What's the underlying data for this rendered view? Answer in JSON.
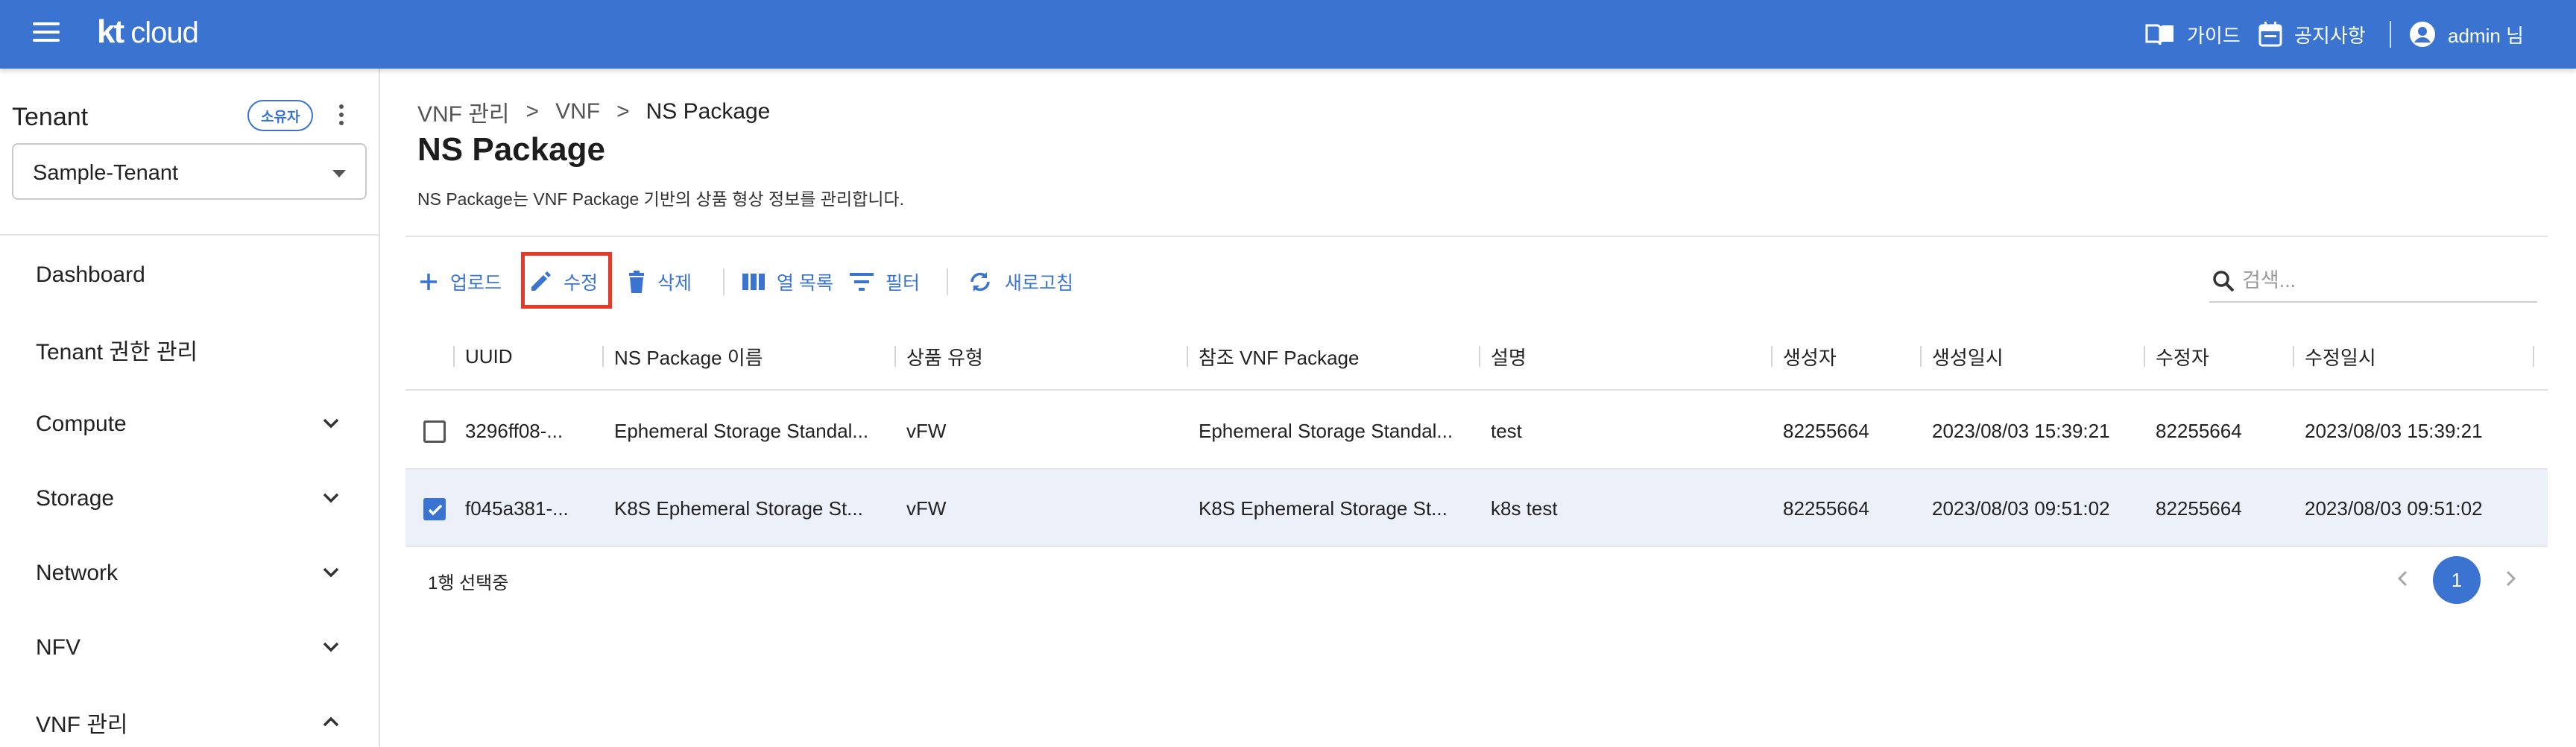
{
  "header": {
    "logo_kt": "kt",
    "logo_cloud": "cloud",
    "guide_label": "가이드",
    "notice_label": "공지사항",
    "user_label": "admin 님",
    "accent": "#3a74d0"
  },
  "sidebar": {
    "tenant_title": "Tenant",
    "owner_badge": "소유자",
    "tenant_value": "Sample-Tenant",
    "items": [
      {
        "label": "Dashboard",
        "expand": "none"
      },
      {
        "label": "Tenant 권한 관리",
        "expand": "none"
      },
      {
        "label": "Compute",
        "expand": "chevron-down"
      },
      {
        "label": "Storage",
        "expand": "chevron-down"
      },
      {
        "label": "Network",
        "expand": "chevron-down"
      },
      {
        "label": "NFV",
        "expand": "chevron-down"
      },
      {
        "label": "VNF 관리",
        "expand": "chevron-up"
      }
    ]
  },
  "breadcrumb": {
    "items": [
      "VNF 관리",
      "VNF",
      "NS Package"
    ],
    "separator": ">"
  },
  "page": {
    "title": "NS Package",
    "description": "NS Package는 VNF Package 기반의 상품 형상 정보를 관리합니다."
  },
  "toolbar": {
    "upload": "업로드",
    "edit": "수정",
    "delete": "삭제",
    "columns": "열 목록",
    "filter": "필터",
    "refresh": "새로고침",
    "search_placeholder": "검색..."
  },
  "table": {
    "columns": [
      "UUID",
      "NS Package 이름",
      "상품 유형",
      "참조 VNF Package",
      "설명",
      "생성자",
      "생성일시",
      "수정자",
      "수정일시"
    ],
    "rows": [
      {
        "checked": false,
        "uuid": "3296ff08-...",
        "name": "Ephemeral Storage Standal...",
        "type": "vFW",
        "ref": "Ephemeral Storage Standal...",
        "desc": "test",
        "creator": "82255664",
        "created": "2023/08/03 15:39:21",
        "modifier": "82255664",
        "modified": "2023/08/03 15:39:21"
      },
      {
        "checked": true,
        "uuid": "f045a381-...",
        "name": "K8S Ephemeral Storage St...",
        "type": "vFW",
        "ref": "K8S Ephemeral Storage St...",
        "desc": "k8s test",
        "creator": "82255664",
        "created": "2023/08/03 09:51:02",
        "modifier": "82255664",
        "modified": "2023/08/03 09:51:02"
      }
    ]
  },
  "footer": {
    "selection": "1행 선택중",
    "page": "1"
  }
}
